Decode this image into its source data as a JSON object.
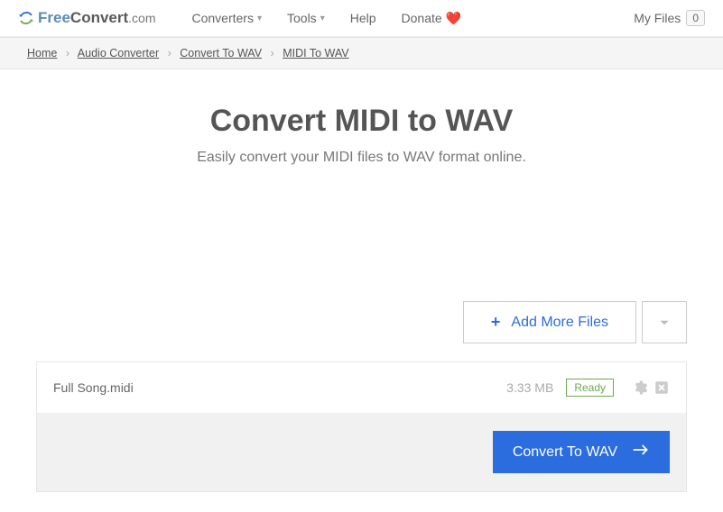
{
  "logo": {
    "free": "Free",
    "convert": "Convert",
    "com": ".com"
  },
  "nav": {
    "converters": "Converters",
    "tools": "Tools",
    "help": "Help",
    "donate": "Donate"
  },
  "myfiles": {
    "label": "My Files",
    "count": "0"
  },
  "breadcrumb": {
    "home": "Home",
    "audio": "Audio Converter",
    "towav": "Convert To WAV",
    "midiwav": "MIDI To WAV"
  },
  "page": {
    "title": "Convert MIDI to WAV",
    "subtitle": "Easily convert your MIDI files to WAV format online."
  },
  "addmore": {
    "label": "Add More Files"
  },
  "file": {
    "name": "Full Song.midi",
    "size": "3.33 MB",
    "status": "Ready"
  },
  "convert": {
    "label": "Convert To WAV"
  }
}
